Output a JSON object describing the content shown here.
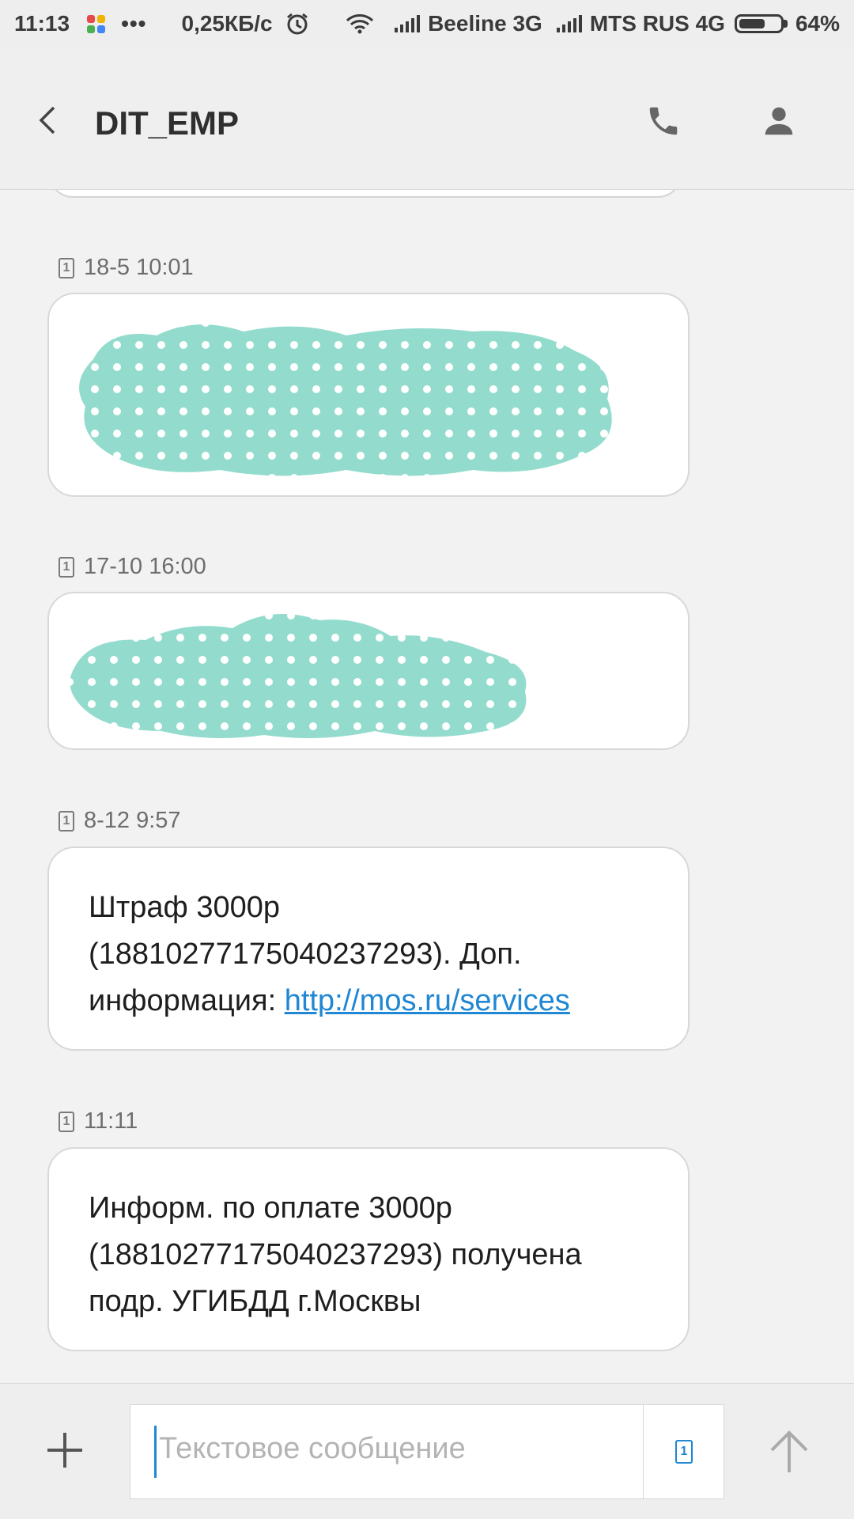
{
  "status_bar": {
    "time": "11:13",
    "more": "•••",
    "net_speed": "0,25КБ/с",
    "sim1_operator": "Beeline 3G",
    "sim2_operator": "MTS RUS 4G",
    "battery_percent": "64%",
    "battery_level": 0.64,
    "icons": [
      "apps-icon",
      "alarm-icon",
      "wifi-icon",
      "signal-icon",
      "signal-icon",
      "battery-icon"
    ]
  },
  "app_bar": {
    "title": "DIT_EMP",
    "icons": [
      "back-arrow-icon",
      "phone-icon",
      "contact-icon"
    ]
  },
  "messages": [
    {
      "sim": "1",
      "timestamp": "18-5 10:01",
      "redacted": true
    },
    {
      "sim": "1",
      "timestamp": "17-10 16:00",
      "redacted": true
    },
    {
      "sim": "1",
      "timestamp": "8-12 9:57",
      "text_line1": "Штраф 3000р",
      "text_line2": "(18810277175040237293). Доп.",
      "text_line3_prefix": "информация: ",
      "link": "http://mos.ru/services"
    },
    {
      "sim": "1",
      "timestamp": "11:11",
      "text_line1": "Информ. по оплате 3000р",
      "text_line2": "(18810277175040237293) получена",
      "text_line3": "подр. УГИБДД г.Москвы"
    }
  ],
  "composer": {
    "placeholder": "Текстовое сообщение",
    "sim_selected": "1",
    "icons": [
      "plus-icon",
      "sim-card-icon",
      "send-arrow-icon"
    ]
  },
  "colors": {
    "accent": "#1f87d3",
    "redaction": "#93dccd",
    "background": "#f2f2f2"
  }
}
